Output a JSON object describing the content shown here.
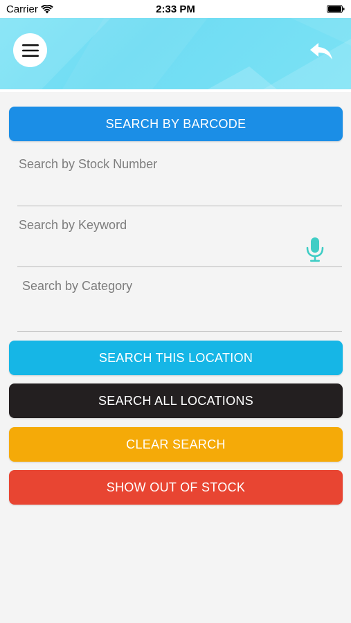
{
  "status_bar": {
    "carrier": "Carrier",
    "time": "2:33 PM"
  },
  "header": {
    "menu_icon": "hamburger-menu-icon",
    "back_icon": "reply-arrow-icon",
    "gradient_color": "#74dff4"
  },
  "search": {
    "barcode_button": "SEARCH BY BARCODE",
    "stock_number_placeholder": "Search by Stock Number",
    "keyword_placeholder": "Search by Keyword",
    "category_placeholder": "Search by Category",
    "mic_icon": "microphone-icon"
  },
  "actions": {
    "search_this_location": "SEARCH THIS LOCATION",
    "search_all_locations": "SEARCH ALL LOCATIONS",
    "clear_search": "CLEAR SEARCH",
    "show_out_of_stock": "SHOW OUT OF STOCK"
  },
  "colors": {
    "barcode_button": "#1b8ee6",
    "search_this_location": "#16b6e6",
    "search_all_locations": "#231f20",
    "clear_search": "#f5aa08",
    "show_out_of_stock": "#e84532",
    "mic_icon": "#3fcdc5"
  }
}
